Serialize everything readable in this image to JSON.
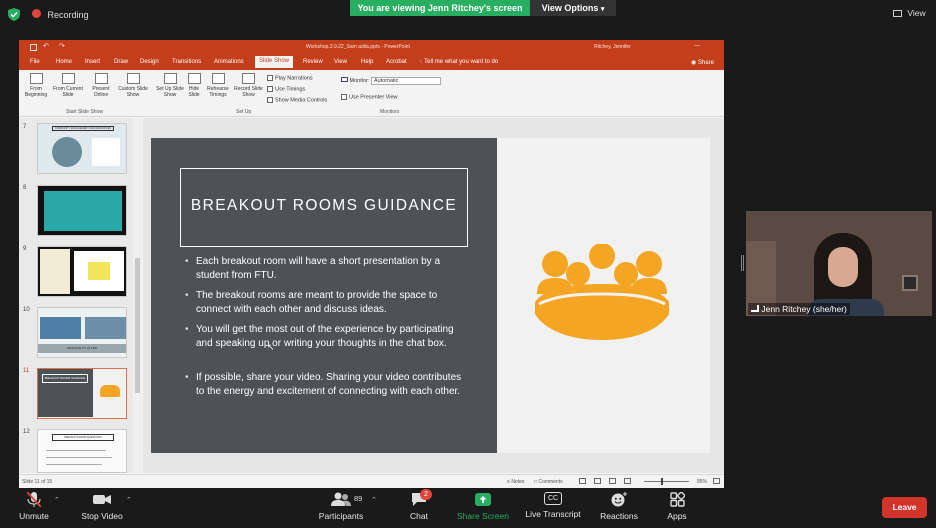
{
  "zoom_topbar": {
    "recording_label": "Recording",
    "viewing_banner": "You are viewing Jenn Ritchey's screen",
    "view_options_label": "View Options",
    "view_label": "View"
  },
  "powerpoint": {
    "file_title": "Workshop.3.9.22_Sam adds.pptx - PowerPoint",
    "user_name": "Ritchey, Jennifer",
    "tabs": [
      "File",
      "Home",
      "Insert",
      "Draw",
      "Design",
      "Transitions",
      "Animations",
      "Slide Show",
      "Review",
      "View",
      "Help",
      "Acrobat"
    ],
    "active_tab": "Slide Show",
    "tell_me": "Tell me what you want to do",
    "share_label": "Share",
    "ribbon": {
      "start_group": "Start Slide Show",
      "setup_group": "Set Up",
      "monitors_group": "Monitors",
      "from_beginning": "From Beginning",
      "from_current": "From Current Slide",
      "present_online": "Present Online",
      "custom_show": "Custom Slide Show",
      "set_up_show": "Set Up Slide Show",
      "hide_slide": "Hide Slide",
      "rehearse": "Rehearse Timings",
      "record": "Record Slide Show",
      "play_narrations": "Play Narrations",
      "use_timings": "Use Timings",
      "show_media_controls": "Show Media Controls",
      "monitor_label": "Monitor:",
      "monitor_value": "Automatic",
      "use_presenter_view": "Use Presenter View"
    },
    "thumbnails": [
      {
        "num": "7",
        "caption": "COMMUNITY ENGAGEMENT AND RESOURCES"
      },
      {
        "num": "8",
        "caption": ""
      },
      {
        "num": "9",
        "caption": ""
      },
      {
        "num": "10",
        "caption": "HIGH QUALITY OF LIFE"
      },
      {
        "num": "11",
        "caption": "BREAKOUT ROOMS GUIDANCE"
      },
      {
        "num": "12",
        "caption": "BREAKOUT ROOM QUESTIONS"
      }
    ],
    "slide": {
      "title": "BREAKOUT ROOMS GUIDANCE",
      "bullets": [
        "Each breakout room will have a short presentation by a student from FTU.",
        "The breakout rooms are meant to provide the space to connect with each other and discuss ideas.",
        "You will get the most out of the experience by participating and speaking up or writing your thoughts in the chat box.",
        "If possible, share your video. Sharing your video contributes to the energy and excitement of connecting with each other."
      ]
    },
    "status": {
      "slide_counter": "Slide 11 of 15",
      "notes_label": "Notes",
      "comments_label": "Comments",
      "zoom_value": "85%"
    }
  },
  "participant_video": {
    "name": "Jenn Ritchey (she/her)"
  },
  "zoom_bottombar": {
    "unmute": "Unmute",
    "stop_video": "Stop Video",
    "participants": "Participants",
    "participant_count": "89",
    "chat": "Chat",
    "chat_badge": "2",
    "share_screen": "Share Screen",
    "live_transcript": "Live Transcript",
    "reactions": "Reactions",
    "apps": "Apps",
    "leave": "Leave"
  },
  "colors": {
    "ppt_red": "#c43e1c",
    "slide_gray": "#4e5254",
    "accent_orange": "#f4a523",
    "zoom_green": "#27ae60",
    "leave_red": "#d2332b"
  }
}
